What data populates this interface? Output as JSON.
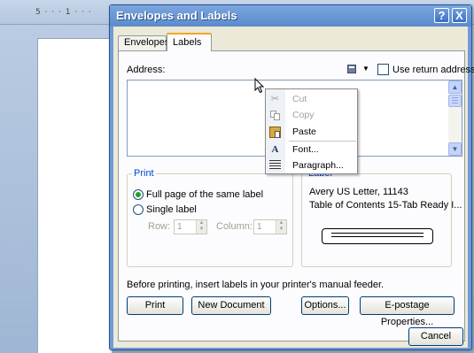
{
  "background": {
    "ruler_text": "5 · · · 1 · · ·"
  },
  "dialog": {
    "title": "Envelopes and Labels",
    "help_glyph": "?",
    "close_glyph": "X",
    "tabs": [
      {
        "label": "Envelopes",
        "active": false
      },
      {
        "label": "Labels",
        "active": true
      }
    ],
    "address_label": "Address:",
    "use_return_address": "Use return address",
    "use_return_address_checked": false,
    "print_group": {
      "title": "Print",
      "full_page": "Full page of the same label",
      "single_label": "Single label",
      "selected": "full_page",
      "row_label": "Row:",
      "row_value": "1",
      "column_label": "Column:",
      "column_value": "1"
    },
    "label_group": {
      "title": "Label",
      "line1": "Avery US Letter, 11143",
      "line2": "Table of Contents 15-Tab Ready I..."
    },
    "note": "Before printing, insert labels in your printer's manual feeder.",
    "buttons": {
      "print": "Print",
      "new_document": "New Document",
      "options": "Options...",
      "epostage": "E-postage Properties...",
      "cancel": "Cancel"
    }
  },
  "context_menu": {
    "items": [
      {
        "label": "Cut",
        "icon": "scissors-icon",
        "enabled": false
      },
      {
        "label": "Copy",
        "icon": "copy-icon",
        "enabled": false
      },
      {
        "label": "Paste",
        "icon": "paste-icon",
        "enabled": true
      },
      {
        "label": "Font...",
        "icon": "font-icon",
        "enabled": true
      },
      {
        "label": "Paragraph...",
        "icon": "paragraph-icon",
        "enabled": true
      }
    ]
  },
  "colors": {
    "titlebar": "#5b8bcb",
    "group_title": "#0046d5",
    "radio_dot": "#21a121",
    "tab_highlight": "#f5a623"
  }
}
